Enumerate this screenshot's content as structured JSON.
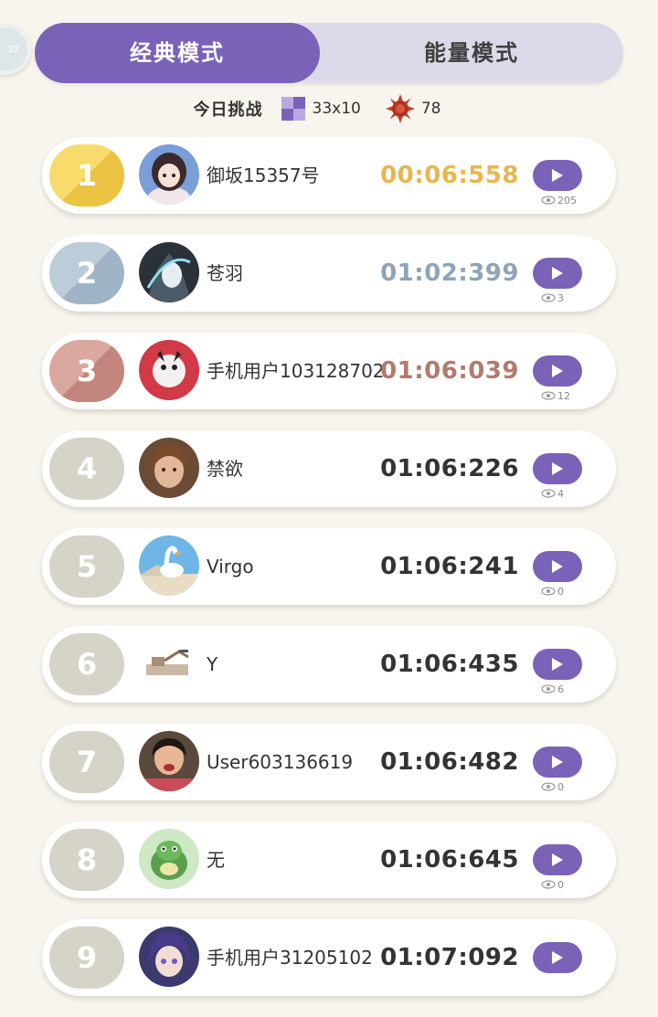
{
  "corner": {
    "label": "22"
  },
  "tabs": [
    {
      "label": "经典模式",
      "active": true
    },
    {
      "label": "能量模式",
      "active": false
    }
  ],
  "challenge": {
    "title": "今日挑战",
    "grid_icon": "grid-icon",
    "grid_value": "33x10",
    "energy_icon": "sun-icon",
    "energy_value": "78"
  },
  "colors": {
    "accent": "#7a62b8",
    "gold": "#f0c94e",
    "silver": "#a9bccd",
    "bronze": "#c78f87",
    "plain_rank": "#d6d3c9"
  },
  "rankings": [
    {
      "rank": "1",
      "name": "御坂15357号",
      "time": "00:06:558",
      "views": "205"
    },
    {
      "rank": "2",
      "name": "苍羽",
      "time": "01:02:399",
      "views": "3"
    },
    {
      "rank": "3",
      "name": "手机用户103128702",
      "time": "01:06:039",
      "views": "12"
    },
    {
      "rank": "4",
      "name": "禁欲",
      "time": "01:06:226",
      "views": "4"
    },
    {
      "rank": "5",
      "name": "Virgo",
      "time": "01:06:241",
      "views": "0"
    },
    {
      "rank": "6",
      "name": "Y",
      "time": "01:06:435",
      "views": "6"
    },
    {
      "rank": "7",
      "name": "User603136619",
      "time": "01:06:482",
      "views": "0"
    },
    {
      "rank": "8",
      "name": "无",
      "time": "01:06:645",
      "views": "0"
    },
    {
      "rank": "9",
      "name": "手机用户31205102",
      "time": "01:07:092",
      "views": ""
    }
  ]
}
